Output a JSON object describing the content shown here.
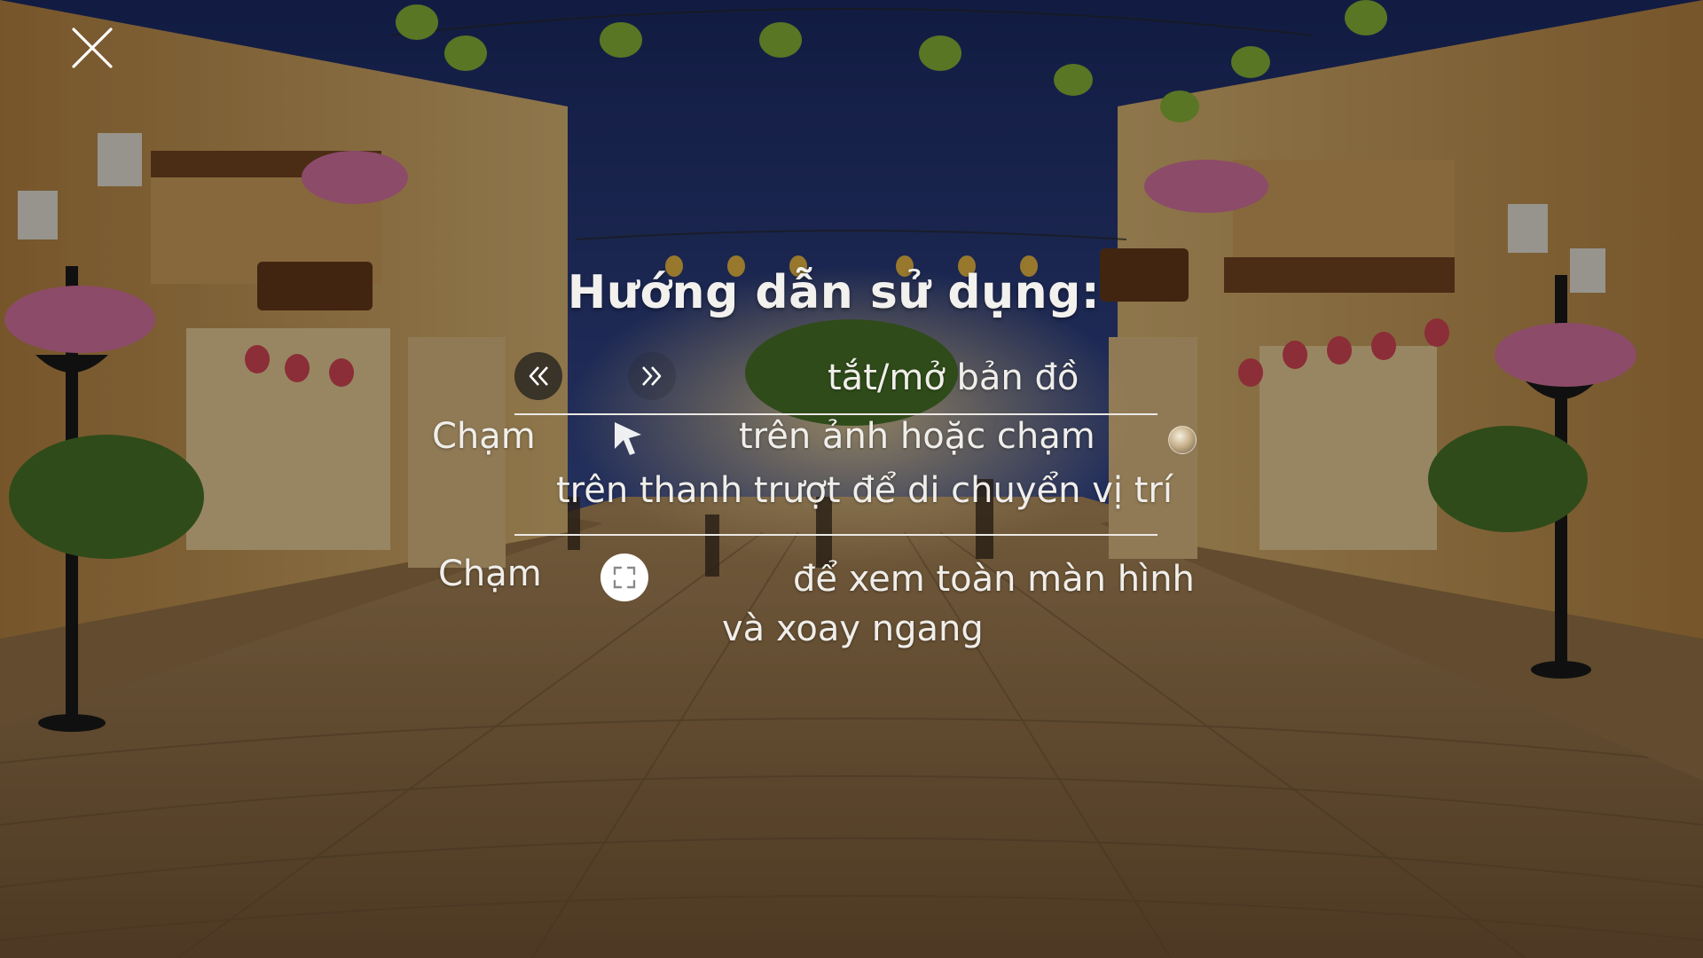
{
  "overlay": {
    "title": "Hướng dẫn sử dụng:",
    "row1": {
      "label": "tắt/mở bản đồ",
      "prev_icon": "double-chevron-left-icon",
      "next_icon": "double-chevron-right-icon"
    },
    "row2": {
      "prefix": "Chạm",
      "line1": "trên ảnh hoặc chạm",
      "line2": "trên thanh trượt để di chuyển vị trí",
      "cursor_icon": "cursor-arrow-icon",
      "slider_icon": "globe-thumb-icon"
    },
    "row3": {
      "prefix": "Chạm",
      "line1": "để xem toàn màn hình",
      "line2": "và xoay ngang",
      "fullscreen_icon": "fullscreen-icon"
    }
  },
  "close_icon": "close-icon",
  "colors": {
    "text": "#f0eeea",
    "divider": "#ebe8e4",
    "overlay_tint": "rgba(0,0,0,0.38)"
  }
}
